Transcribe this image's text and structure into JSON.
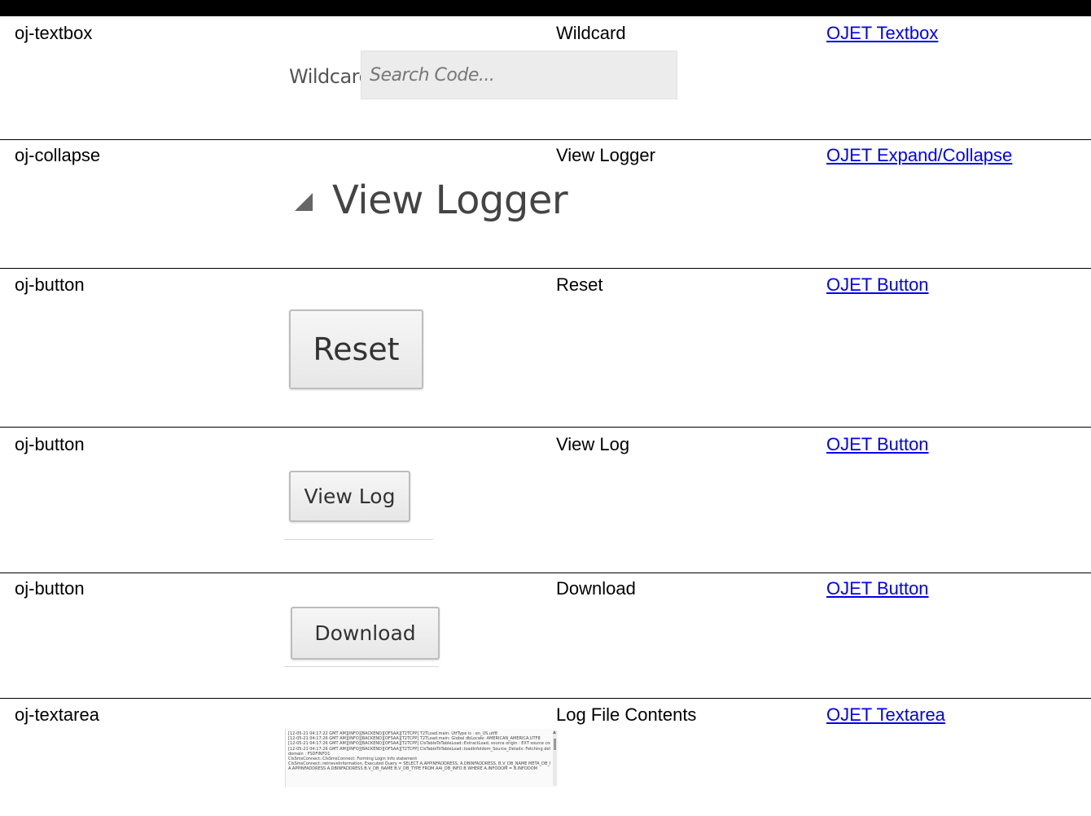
{
  "rows": [
    {
      "component": "oj-textbox",
      "label": "Wildcard",
      "link": "OJET Textbox",
      "preview": {
        "field_label": "Wildcard",
        "placeholder": "Search Code..."
      }
    },
    {
      "component": "oj-collapse",
      "label": "View Logger",
      "link": "OJET Expand/Collapse",
      "preview": {
        "text": "View Logger",
        "icon": "collapse-triangle-icon"
      }
    },
    {
      "component": "oj-button",
      "label": "Reset",
      "link": "OJET Button",
      "preview": {
        "button_label": "Reset"
      }
    },
    {
      "component": "oj-button",
      "label": "View Log",
      "link": "OJET Button",
      "preview": {
        "button_label": "View Log"
      }
    },
    {
      "component": "oj-button",
      "label": "Download",
      "link": "OJET Button",
      "preview": {
        "button_label": "Download"
      }
    },
    {
      "component": "oj-textarea",
      "label": "Log File Contents",
      "link": "OJET Textarea",
      "preview": {
        "lines": [
          "[12-05-21 04:17:22 GMT AM][INFO][BACKEND][OFSAA][T2TCPP] T2TLoad.main: UtfType is : en_US.utf8",
          "[12-05-21 04:17:26 GMT AM][INFO][BACKEND][OFSAA][T2TCPP] T2TLoad.main: Global dbLocale: AMERICAN_AMERICA.UTF8",
          "[12-05-21 04:17:26 GMT AM][INFO][BACKEND][OFSAA][T2TCPP] CIsTableToTableLoad::ExtractLoad, source origin : EXT source code : FSDF_SRC1",
          "[12-05-21 04:17:26 GMT AM][INFO][BACKEND][OFSAA][T2TCPP] CIsTableToTableLoad::loadInfoIdom_Source_Details: Fetching details for information",
          "domain : FSDFINFO1",
          "CIsSmsConnect::CIsSmsConnect: Forming Login Info statement",
          "CIsSmsConnect::retrieveInformation, Executed Query = SELECT A.APPINFADDRESS, A.DBINFADDRESS, B.V_DB_NAME META_DB_NAME, B.V_DB_TYPE",
          "A.APPINFADDRESS A.DBINFADDRESS B.V_DB_NAME B.V_DB_TYPE FROM AAI_DB_INFO B WHERE A.INFODOM = B.INFODOM"
        ]
      }
    }
  ]
}
